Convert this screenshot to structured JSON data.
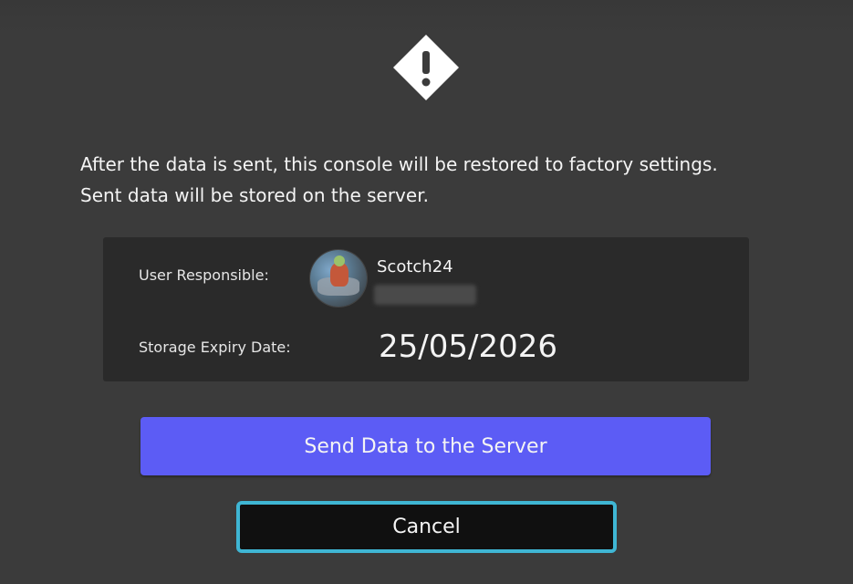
{
  "dialog": {
    "icon": "warning-diamond-icon",
    "message_lines": [
      "After the data is sent, this console will be restored to factory settings.",
      "Sent data will be stored on the server."
    ],
    "info": {
      "user_label": "User Responsible:",
      "username": "Scotch24",
      "avatar": "user-avatar-icon",
      "expiry_label": "Storage Expiry Date:",
      "expiry_value": "25/05/2026"
    },
    "buttons": {
      "send": "Send Data to the Server",
      "cancel": "Cancel"
    }
  },
  "colors": {
    "background": "#3b3b3b",
    "panel": "#2a2a2a",
    "send_button": "#5c5cf5",
    "cancel_button": "#101010",
    "focus_border": "#3fb6d4"
  }
}
